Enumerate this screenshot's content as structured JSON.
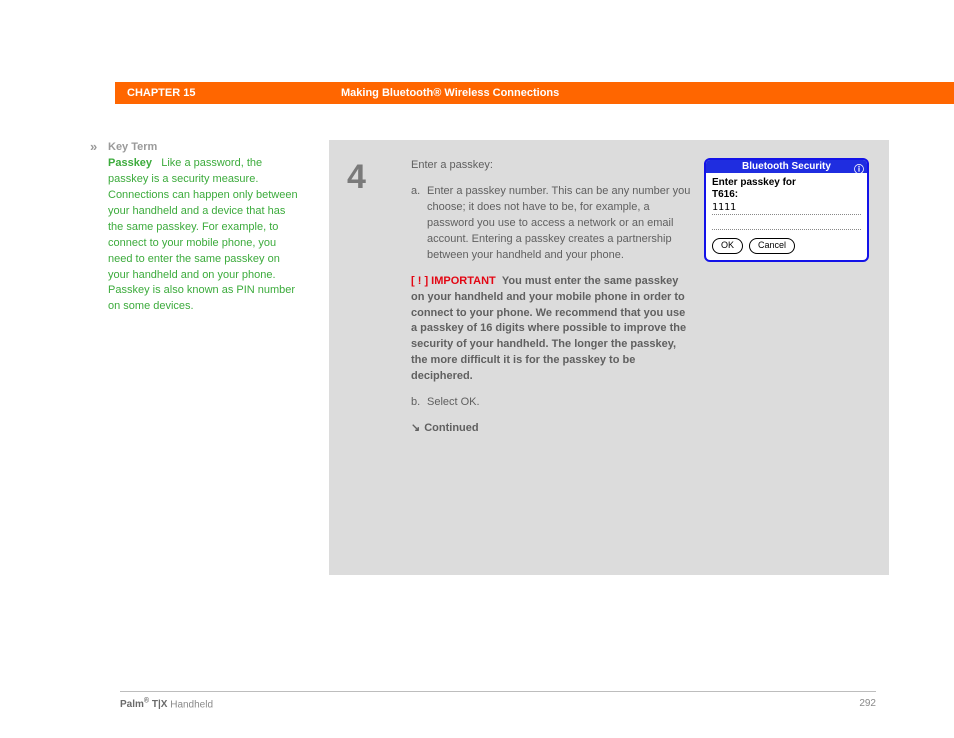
{
  "header": {
    "chapter": "CHAPTER 15",
    "title": "Making Bluetooth® Wireless Connections"
  },
  "sidebar": {
    "marker": "»",
    "heading": "Key Term",
    "term": "Passkey",
    "body": "Like a password, the passkey is a security measure. Connections can happen only between your handheld and a device that has the same passkey. For example, to connect to your mobile phone, you need to enter the same passkey on your handheld and on your phone. Passkey is also known as PIN number on some devices."
  },
  "step": {
    "number": "4",
    "intro": "Enter a passkey:",
    "item_a_letter": "a.",
    "item_a_text": "Enter a passkey number. This can be any number you choose; it does not have to be, for example, a password you use to access a network or an email account. Entering a passkey creates a partnership between your handheld and your phone.",
    "important_bang": "[ ! ]",
    "important_label": "IMPORTANT",
    "important_text": "You must enter the same passkey on your handheld and your mobile phone in order to connect to your phone. We recommend that you use a passkey of 16 digits where possible to improve the security of your handheld. The longer the passkey, the more difficult it is for the passkey to be deciphered.",
    "item_b_letter": "b.",
    "item_b_text": "Select OK.",
    "continued_arrow": "↘",
    "continued_label": "Continued"
  },
  "dialog": {
    "title": "Bluetooth Security",
    "info": "ⓘ",
    "prompt_line1": "Enter passkey for",
    "prompt_line2": "T616:",
    "field_value": "1111",
    "ok": "OK",
    "cancel": "Cancel"
  },
  "footer": {
    "brand_strong": "Palm",
    "brand_reg": "®",
    "brand_model": " T|X",
    "brand_tail": " Handheld",
    "page": "292"
  }
}
